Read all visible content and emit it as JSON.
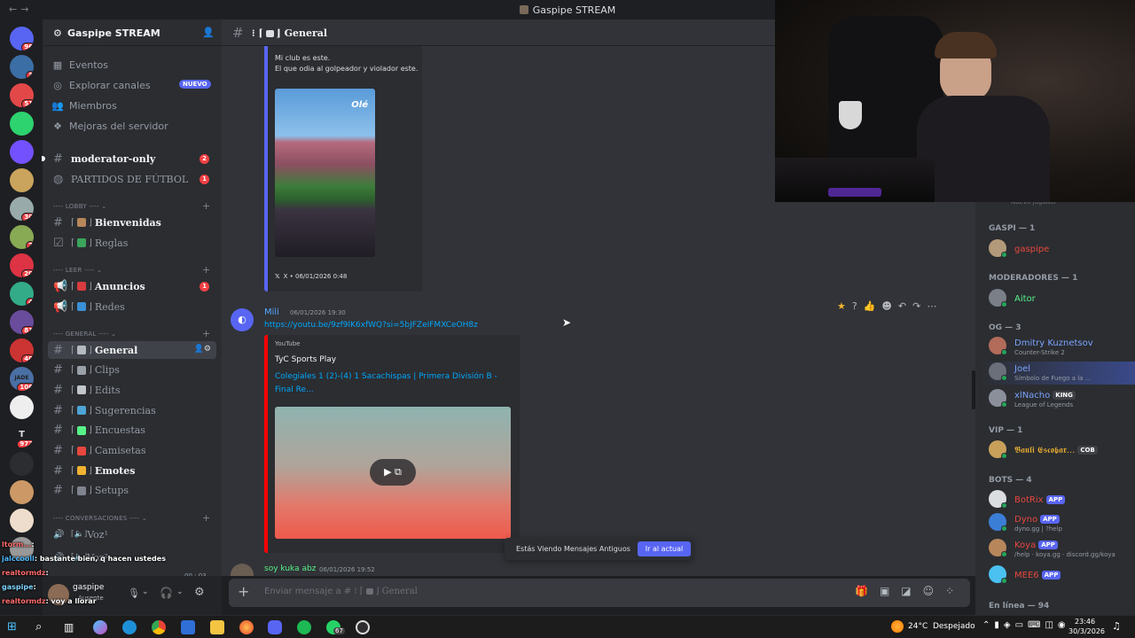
{
  "window": {
    "title": "Gaspipe STREAM"
  },
  "server_badges": [
    "96",
    "3",
    "51",
    "",
    "",
    "",
    "30",
    "7",
    "20",
    "4",
    "81",
    "40",
    "106",
    "",
    "972",
    "",
    "",
    "",
    ""
  ],
  "server_letters": {
    "t": "T",
    "jade": "JADE"
  },
  "guild": {
    "name": "Gaspipe STREAM",
    "nav": [
      {
        "label": "Eventos",
        "icon": "calendar-icon"
      },
      {
        "label": "Explorar canales",
        "icon": "compass-icon",
        "badge": "NUEVO"
      },
      {
        "label": "Miembros",
        "icon": "members-icon"
      },
      {
        "label": "Mejoras del servidor",
        "icon": "boost-icon"
      }
    ]
  },
  "channels_top": [
    {
      "label": "moderator-only",
      "count": "2"
    },
    {
      "label": "PARTIDOS DE FÚTBOL",
      "count": "1"
    }
  ],
  "categories": {
    "lobby": "---- LOBBY ----",
    "leer": "---- LEER ----",
    "general": "---- GENERAL ----",
    "conv": "---- CONVERSACIONES ----"
  },
  "lobby_channels": [
    {
      "label": "Bienvenidas"
    },
    {
      "label": "Reglas"
    }
  ],
  "leer_channels": [
    {
      "label": "Anuncios",
      "count": "1"
    },
    {
      "label": "Redes"
    }
  ],
  "general_channels": [
    {
      "label": "General"
    },
    {
      "label": "Clips"
    },
    {
      "label": "Edits"
    },
    {
      "label": "Sugerencias"
    },
    {
      "label": "Encuestas"
    },
    {
      "label": "Camisetas"
    },
    {
      "label": "Emotes"
    },
    {
      "label": "Setups"
    }
  ],
  "voice_channels": [
    "Voz¹",
    "Voz²"
  ],
  "header": {
    "channel": "General"
  },
  "messages": {
    "m1": {
      "line1": "Mi club es este.",
      "line2": "El que odia al golpeador y violador este.",
      "img_label": "Olé",
      "footer": "X • 06/01/2026 0:48"
    },
    "m2": {
      "author": "Mili",
      "time": "06/01/2026 19:30",
      "link": "https://youtu.be/9zf9lK6xfWQ?si=5bJFZeIFMXCeOH8z",
      "provider": "YouTube",
      "site": "TyC Sports Play",
      "video_title_1": "Colegiales 1 (2)-(4) 1 Sacachispas | Primera División B -",
      "video_title_2": "Final Re..."
    },
    "m3": {
      "author": "soy kuka abz",
      "time": "06/01/2026 19:52"
    }
  },
  "old_banner": {
    "text": "Estás Viendo Mensajes Antiguos",
    "button": "Ir al actual"
  },
  "input": {
    "placeholder": "Enviar mensaje a #",
    "channel": "General"
  },
  "members": {
    "cats": [
      "GASPI — 1",
      "MODERADORES — 1",
      "OG — 3",
      "VIP — 1",
      "BOTS — 4",
      "En línea — 94"
    ],
    "gaspi": [
      {
        "name": "gaspipe",
        "color": "#e8473e"
      }
    ],
    "mods": [
      {
        "name": "Aitor",
        "color": "#57f287"
      }
    ],
    "og": [
      {
        "name": "Dmitry Kuznetsov",
        "status": "Counter-Strike 2",
        "color": "#7aa3ff"
      },
      {
        "name": "Joel",
        "status": "Símbolo de Fuego a la ...",
        "color": "#7aa3ff"
      },
      {
        "name": "xlNacho",
        "status": "League of Legends",
        "tag": "KING",
        "color": "#7aa3ff"
      }
    ],
    "vip": [
      {
        "name": "𝕭𝖆𝖚𝖑𝖎 𝕰𝖘𝖈𝖔𝖇𝖆𝖗...",
        "tag": "COB",
        "color": "#f0b232"
      }
    ],
    "bots": [
      {
        "name": "BotRix",
        "tag": "APP",
        "status": "",
        "color": "#e8473e"
      },
      {
        "name": "Dyno",
        "tag": "APP",
        "status": "dyno.gg | ?help",
        "color": "#e8473e"
      },
      {
        "name": "Koya",
        "tag": "APP",
        "status": "/help · koya.gg · discord.gg/koya",
        "color": "#e8473e"
      },
      {
        "name": "MEE6",
        "tag": "APP",
        "status": "",
        "color": "#e8473e"
      }
    ],
    "partial": "Nuevo jugador"
  },
  "stream_chat": [
    {
      "u": "ltorm...",
      "t": ""
    },
    {
      "u": "jalccooll",
      "t": "bastante bien, q hacen ustedes"
    },
    {
      "u": "realtormdz",
      "t": ""
    },
    {
      "u": "gaspipe",
      "t": ""
    },
    {
      "u": "realtormdz",
      "t": "voy a llorar"
    }
  ],
  "userbar": {
    "name": "gaspipe",
    "status": "Ausente",
    "voice_count": "00 : 03"
  },
  "taskbar": {
    "weather": "24°C  Despejado",
    "time": "23:46",
    "date": "30/3/2026",
    "whatsapp_badge": "67"
  },
  "colors": {
    "accent": "#5865f2",
    "danger": "#f23f43",
    "link": "#00a8fc",
    "nuevo": "#5865f2"
  }
}
